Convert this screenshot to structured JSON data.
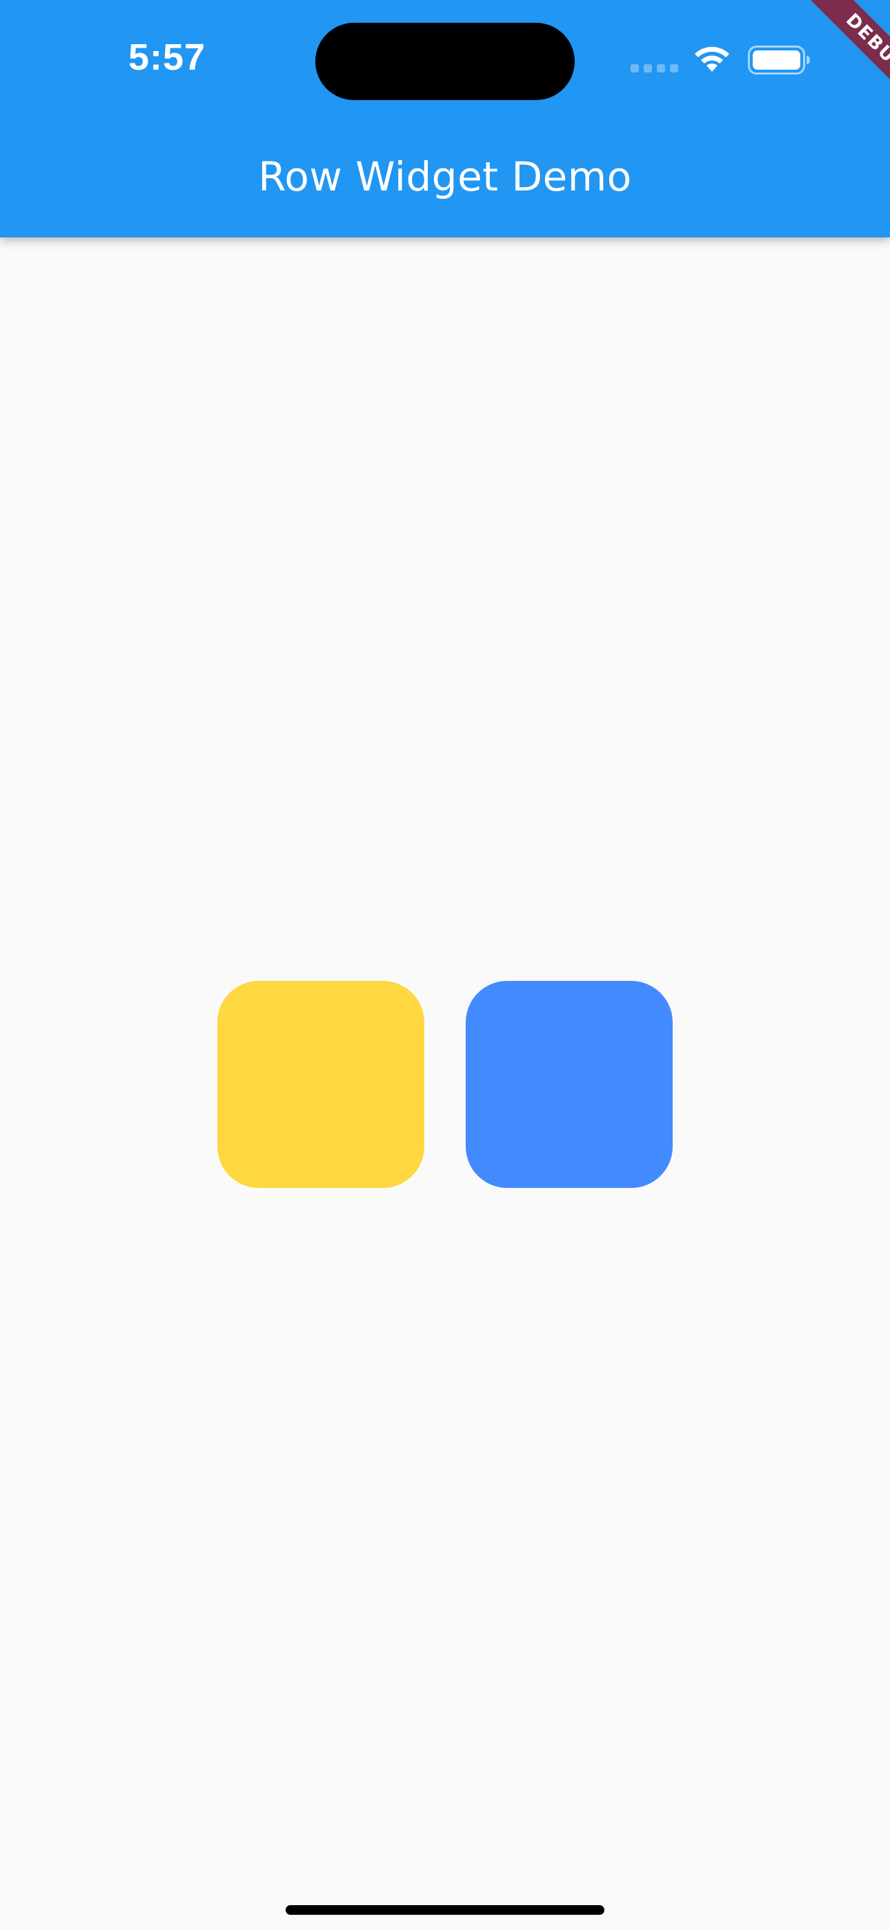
{
  "status_bar": {
    "time": "5:57"
  },
  "app_bar": {
    "title": "Row Widget Demo",
    "color": "#2196f3"
  },
  "debug_banner": {
    "label": "DEBUG",
    "color": "#7b2d4b"
  },
  "row": {
    "boxes": [
      {
        "color": "#ffd740"
      },
      {
        "color": "#448aff"
      }
    ]
  },
  "icons": {
    "signal": "cellular-signal-icon",
    "wifi": "wifi-icon",
    "battery": "battery-icon"
  }
}
